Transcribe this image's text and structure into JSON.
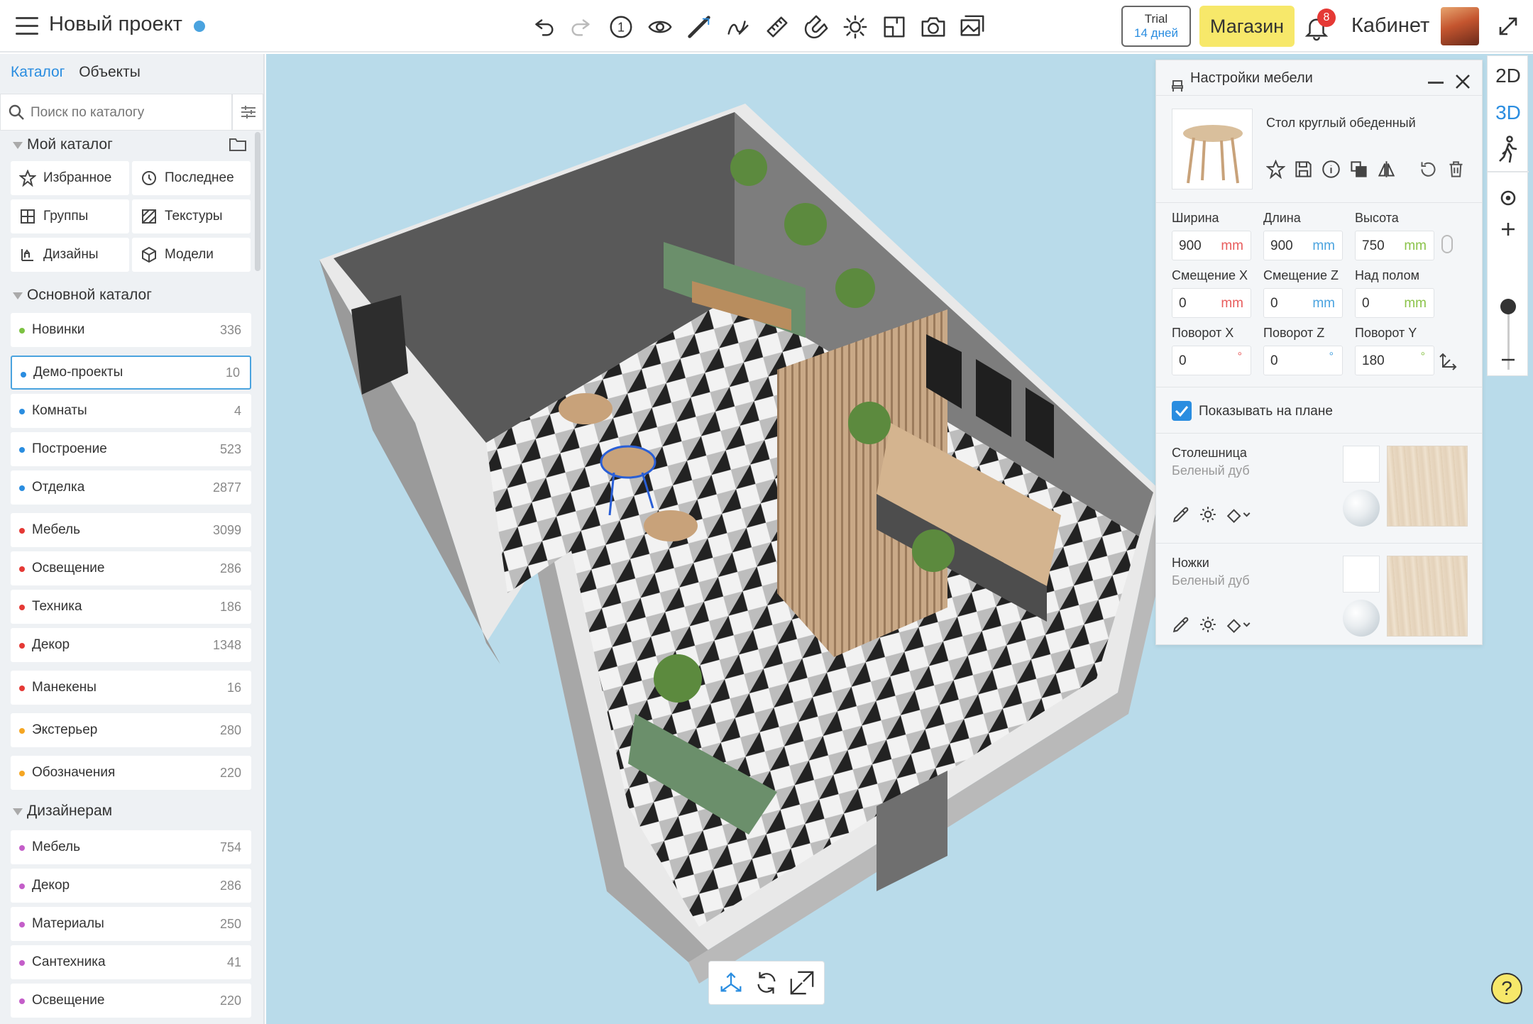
{
  "header": {
    "project_title": "Новый проект",
    "trial_label": "Trial",
    "trial_days": "14 дней",
    "shop_label": "Магазин",
    "notifications_count": "8",
    "cabinet_label": "Кабинет",
    "toolbar_icons": [
      "undo-icon",
      "redo-icon",
      "level-1-icon",
      "eye-icon",
      "wall-tool-icon",
      "curve-icon",
      "ruler-icon",
      "magnet-icon",
      "sun-icon",
      "room-icon",
      "camera-icon",
      "render-icon"
    ],
    "level_number": "1"
  },
  "sidebar": {
    "tabs": [
      {
        "label": "Каталог"
      },
      {
        "label": "Объекты"
      }
    ],
    "search_placeholder": "Поиск по каталогу",
    "my_catalog": "Мой каталог",
    "quick": [
      {
        "label": "Избранное",
        "icon": "star-icon"
      },
      {
        "label": "Последнее",
        "icon": "clock-icon"
      },
      {
        "label": "Группы",
        "icon": "grid-icon"
      },
      {
        "label": "Текстуры",
        "icon": "texture-icon"
      },
      {
        "label": "Дизайны",
        "icon": "designs-icon"
      },
      {
        "label": "Модели",
        "icon": "cube-icon"
      }
    ],
    "main_catalog": "Основной каталог",
    "main_items": [
      {
        "label": "Новинки",
        "count": "336",
        "color": "#7cc242"
      },
      {
        "label": "Демо-проекты",
        "count": "10",
        "color": "#2a8de0"
      },
      {
        "label": "Комнаты",
        "count": "4",
        "color": "#2a8de0"
      },
      {
        "label": "Построение",
        "count": "523",
        "color": "#2a8de0"
      },
      {
        "label": "Отделка",
        "count": "2877",
        "color": "#2a8de0"
      },
      {
        "label": "Мебель",
        "count": "3099",
        "color": "#e53935"
      },
      {
        "label": "Освещение",
        "count": "286",
        "color": "#e53935"
      },
      {
        "label": "Техника",
        "count": "186",
        "color": "#e53935"
      },
      {
        "label": "Декор",
        "count": "1348",
        "color": "#e53935"
      },
      {
        "label": "Манекены",
        "count": "16",
        "color": "#e53935"
      },
      {
        "label": "Экстерьер",
        "count": "280",
        "color": "#f5a623"
      },
      {
        "label": "Обозначения",
        "count": "220",
        "color": "#f5a623"
      }
    ],
    "designers": "Дизайнерам",
    "designer_items": [
      {
        "label": "Мебель",
        "count": "754",
        "color": "#c45ec9"
      },
      {
        "label": "Декор",
        "count": "286",
        "color": "#c45ec9"
      },
      {
        "label": "Материалы",
        "count": "250",
        "color": "#c45ec9"
      },
      {
        "label": "Сантехника",
        "count": "41",
        "color": "#c45ec9"
      },
      {
        "label": "Освещение",
        "count": "220",
        "color": "#c45ec9"
      }
    ]
  },
  "panel": {
    "title": "Настройки мебели",
    "item_name": "Стол круглый обеденный",
    "fields": [
      {
        "label": "Ширина",
        "value": "900",
        "unit": "mm",
        "unit_color": "#e85c5c"
      },
      {
        "label": "Длина",
        "value": "900",
        "unit": "mm",
        "unit_color": "#4aa3df"
      },
      {
        "label": "Высота",
        "value": "750",
        "unit": "mm",
        "unit_color": "#8bc34a"
      },
      {
        "label": "Смещение X",
        "value": "0",
        "unit": "mm",
        "unit_color": "#e85c5c"
      },
      {
        "label": "Смещение Z",
        "value": "0",
        "unit": "mm",
        "unit_color": "#4aa3df"
      },
      {
        "label": "Над полом",
        "value": "0",
        "unit": "mm",
        "unit_color": "#8bc34a"
      },
      {
        "label": "Поворот X",
        "value": "0",
        "unit": "°",
        "unit_color": "#e85c5c"
      },
      {
        "label": "Поворот Z",
        "value": "0",
        "unit": "°",
        "unit_color": "#4aa3df"
      },
      {
        "label": "Поворот Y",
        "value": "180",
        "unit": "°",
        "unit_color": "#8bc34a"
      }
    ],
    "show_on_plan": "Показывать на плане",
    "materials": [
      {
        "title": "Столешница",
        "material": "Беленый дуб"
      },
      {
        "title": "Ножки",
        "material": "Беленый дуб"
      }
    ]
  },
  "rightbar": {
    "mode_2d": "2D",
    "mode_3d": "3D",
    "zoom_level": 0.5
  },
  "help_label": "?"
}
